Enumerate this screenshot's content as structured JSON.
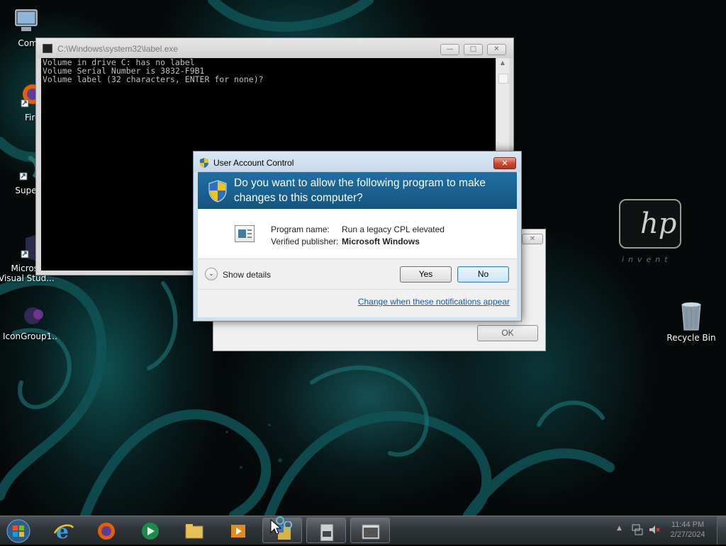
{
  "desktop": {
    "icons": [
      {
        "label": "Compu",
        "icon": "computer-icon"
      },
      {
        "label": "Firefo",
        "icon": "firefox-icon"
      },
      {
        "label": "Superm",
        "icon": "shortcut-icon"
      },
      {
        "label": "Micros",
        "label2": "Visual Stud...",
        "icon": "visual-studio-icon"
      },
      {
        "label": "IconGroup1...",
        "icon": "icon-group-icon"
      },
      {
        "label": "Recycle Bin",
        "icon": "recycle-bin-icon"
      }
    ],
    "brand_tagline": "invent"
  },
  "console": {
    "title": "C:\\Windows\\system32\\label.exe",
    "lines": [
      "Volume in drive C: has no label",
      "Volume Serial Number is 3832-F9B1",
      "Volume label (32 characters, ENTER for none)?"
    ]
  },
  "background_dialog": {
    "close_label": "✕",
    "ok_label": "OK"
  },
  "uac": {
    "title": "User Account Control",
    "question": "Do you want to allow the following program to make changes to this computer?",
    "program_name_label": "Program name:",
    "program_name": "Run a legacy CPL elevated",
    "publisher_label": "Verified publisher:",
    "publisher": "Microsoft Windows",
    "show_details": "Show details",
    "yes_label": "Yes",
    "no_label": "No",
    "change_link": "Change when these notifications appear",
    "close_label": "✕"
  },
  "taskbar": {
    "items": [
      "start-orb",
      "internet-explorer-icon",
      "firefox-icon",
      "media-center-icon",
      "file-explorer-icon",
      "media-player-icon",
      "control-panel-icon",
      "disk-drive-icon",
      "console-icon"
    ],
    "clock_time": "11:44 PM",
    "clock_date": "2/27/2024"
  },
  "colors": {
    "uac_banner": "#1f6fa3",
    "link": "#1a5aa8",
    "desktop_teal": "#0f4f50"
  }
}
